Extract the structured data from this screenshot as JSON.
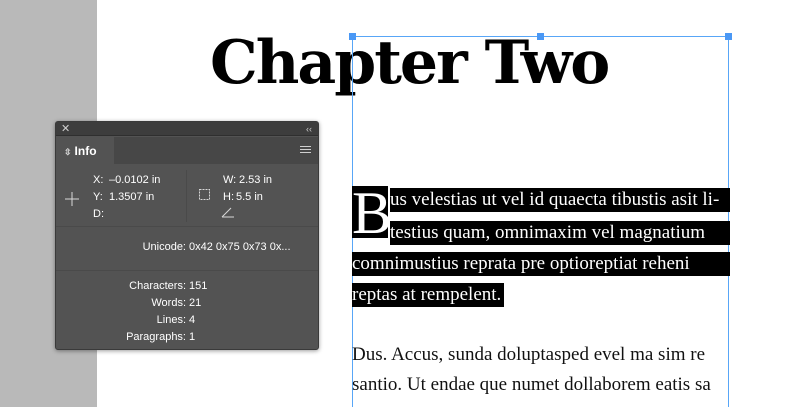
{
  "document": {
    "chapter_title": "Chapter Two",
    "drop_cap": "B",
    "selected_lines": [
      "us velestias ut vel id quaecta tibustis asit li-",
      "testius quam, omnimaxim vel magnatium",
      "comnimustius reprata pre optioreptiat reheni",
      "reptas at rempelent."
    ],
    "body_lines": [
      "Dus. Accus, sunda doluptasped evel ma sim re",
      "santio. Ut endae que numet dollaborem eatis sa"
    ]
  },
  "info_panel": {
    "tab_label": "Info",
    "position": {
      "x_label": "X:",
      "x_value": "–0.0102 in",
      "y_label": "Y:",
      "y_value": "1.3507 in",
      "d_label": "D:"
    },
    "size": {
      "w_label": "W:",
      "w_value": "2.53 in",
      "h_label": "H:",
      "h_value": "5.5 in"
    },
    "unicode_label": "Unicode:",
    "unicode_value": "0x42 0x75 0x73 0x...",
    "stats": {
      "characters_label": "Characters:",
      "characters_value": "151",
      "words_label": "Words:",
      "words_value": "21",
      "lines_label": "Lines:",
      "lines_value": "4",
      "paragraphs_label": "Paragraphs:",
      "paragraphs_value": "1"
    }
  },
  "icons": {
    "close": "close-icon",
    "collapse": "collapse-panel-icon",
    "menu": "panel-menu-icon",
    "crosshair": "crosshair-icon",
    "frame_size": "frame-size-icon",
    "angle": "angle-icon"
  },
  "colors": {
    "selection": "#000000",
    "frame": "#58a6f7",
    "panel_bg": "#535353"
  }
}
